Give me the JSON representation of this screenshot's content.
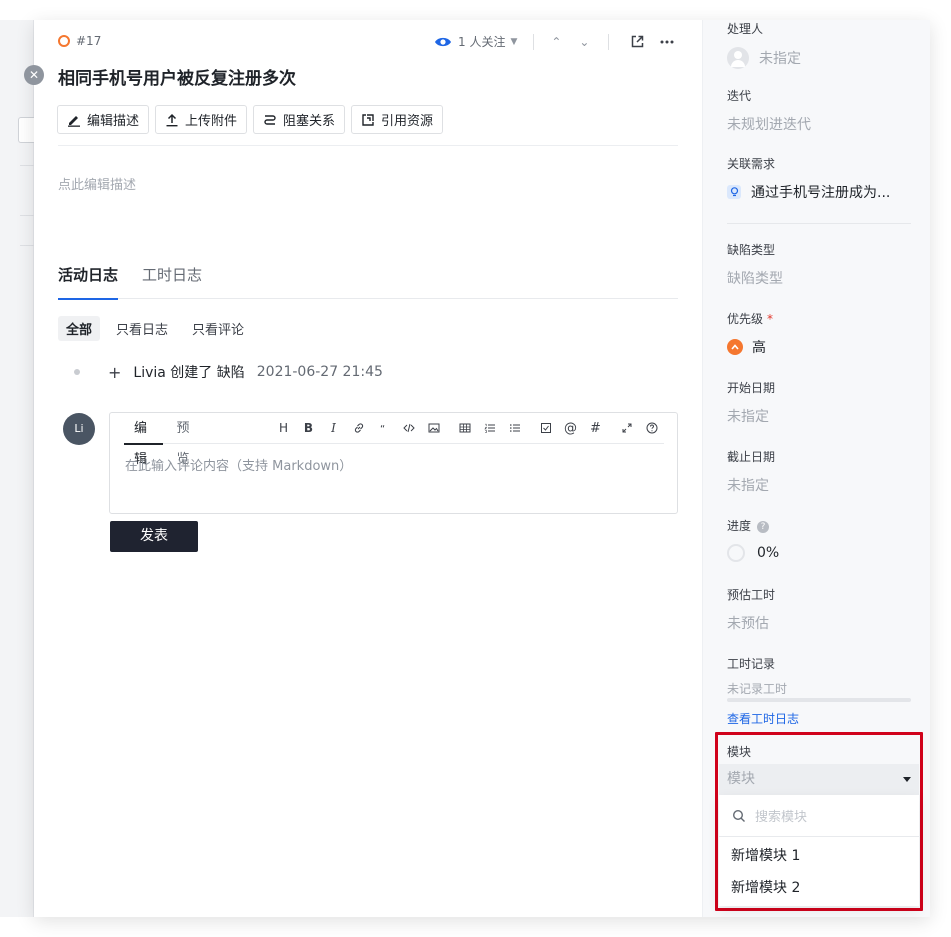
{
  "issue": {
    "id": "#17",
    "title": "相同手机号用户被反复注册多次",
    "followers": "1 人关注"
  },
  "toolbar": {
    "edit_desc": "编辑描述",
    "upload": "上传附件",
    "blocking": "阻塞关系",
    "reference": "引用资源"
  },
  "description": {
    "placeholder": "点此编辑描述"
  },
  "tabs": {
    "activity": "活动日志",
    "worklog": "工时日志"
  },
  "filters": {
    "all": "全部",
    "logs_only": "只看日志",
    "comments_only": "只看评论"
  },
  "activity_log": [
    {
      "text": "Livia 创建了 缺陷",
      "time": "2021-06-27 21:45"
    }
  ],
  "comment": {
    "avatar": "Li",
    "tab_edit": "编辑",
    "tab_preview": "预览",
    "placeholder": "在此输入评论内容（支持 Markdown）",
    "submit": "发表",
    "tools": [
      "H",
      "B",
      "I"
    ]
  },
  "sidebar": {
    "assignee": {
      "label": "处理人",
      "value": "未指定"
    },
    "iteration": {
      "label": "迭代",
      "value": "未规划进迭代"
    },
    "related_req": {
      "label": "关联需求",
      "value": "通过手机号注册成为..."
    },
    "defect_type": {
      "label": "缺陷类型",
      "value": "缺陷类型"
    },
    "priority": {
      "label": "优先级",
      "required": "*",
      "value": "高"
    },
    "start_date": {
      "label": "开始日期",
      "value": "未指定"
    },
    "due_date": {
      "label": "截止日期",
      "value": "未指定"
    },
    "progress": {
      "label": "进度",
      "help": "?",
      "value": "0%"
    },
    "estimate": {
      "label": "预估工时",
      "value": "未预估"
    },
    "worklog": {
      "label": "工时记录",
      "value": "未记录工时",
      "link": "查看工时日志",
      "fill_percent": 0
    },
    "module": {
      "label": "模块",
      "placeholder": "模块",
      "search_placeholder": "搜索模块",
      "options": [
        "新增模块 1",
        "新增模块 2"
      ]
    }
  },
  "colors": {
    "accent": "#1e66e5",
    "bug": "#f5772f",
    "highlight": "#d0021b",
    "submit_bg": "#1f2330"
  }
}
